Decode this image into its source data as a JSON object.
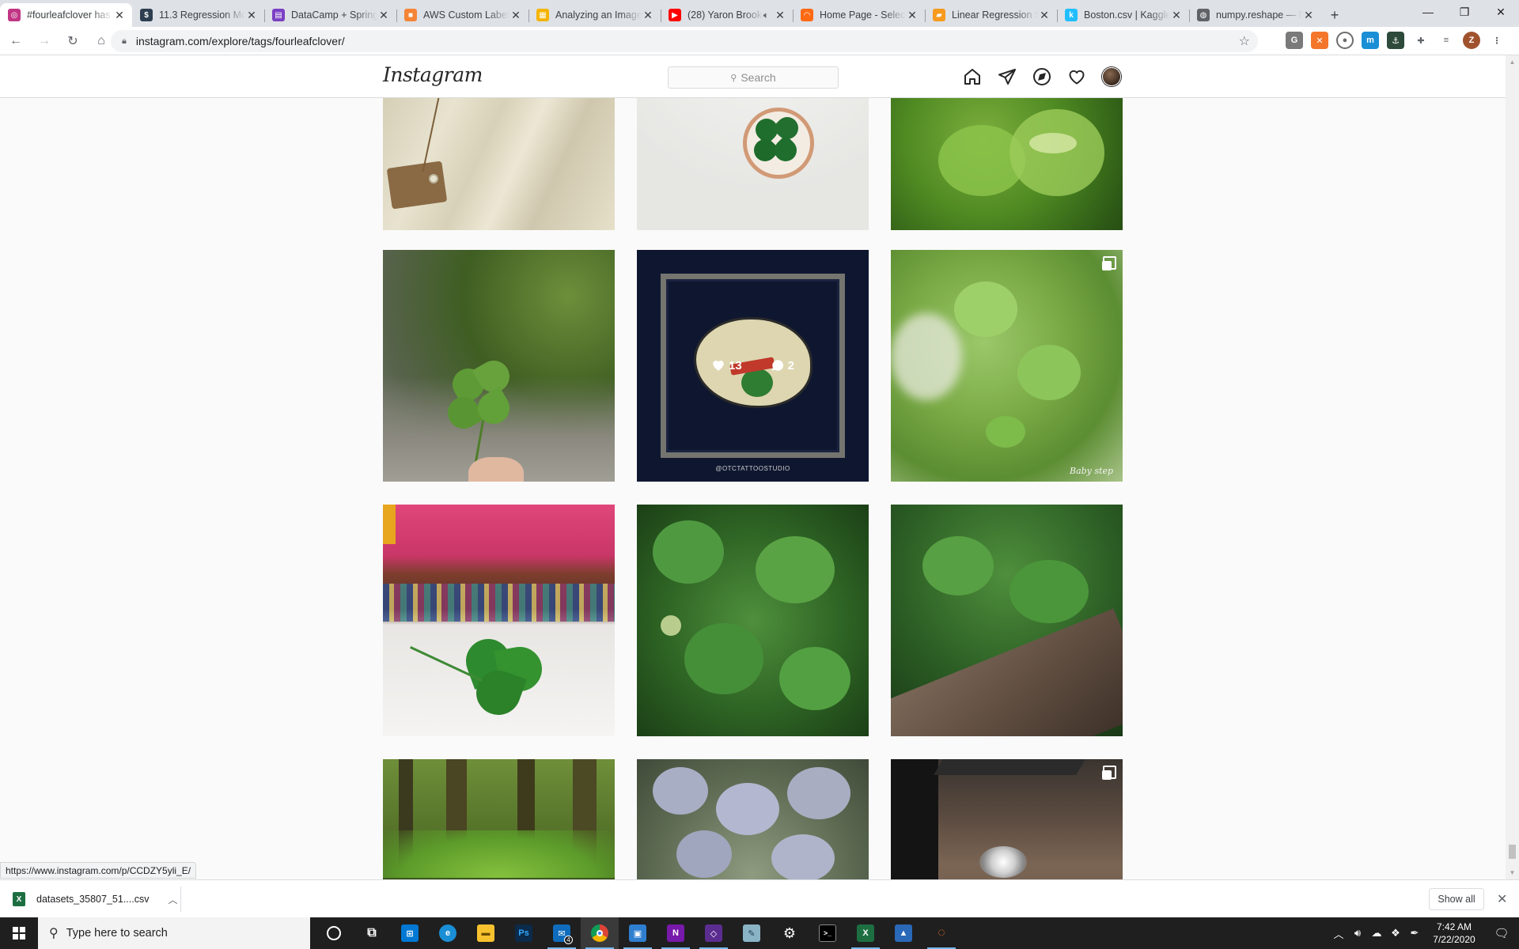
{
  "browser": {
    "tabs": [
      {
        "title": "#fourleafclover has",
        "favicon": "instagram-icon",
        "color": "#c13584",
        "glyph": "◎",
        "active": true
      },
      {
        "title": "11.3 Regression Mo",
        "favicon": "dollar-icon",
        "color": "#2d3e50",
        "glyph": "$"
      },
      {
        "title": "DataCamp + Spring",
        "favicon": "sheet-icon",
        "color": "#7b3fc4",
        "glyph": "▤"
      },
      {
        "title": "AWS Custom Labels",
        "favicon": "aws-cube-icon",
        "color": "#f58536",
        "glyph": "■"
      },
      {
        "title": "Analyzing an Image",
        "favicon": "aws-doc-icon",
        "color": "#f4b400",
        "glyph": "▦"
      },
      {
        "title": "(28) Yaron Brook",
        "favicon": "youtube-icon",
        "color": "#ff0000",
        "glyph": "▶",
        "audio": true
      },
      {
        "title": "Home Page - Select",
        "favicon": "select-icon",
        "color": "#ff6a13",
        "glyph": "◠"
      },
      {
        "title": "Linear Regression Si",
        "favicon": "book-icon",
        "color": "#f79a1e",
        "glyph": "▰"
      },
      {
        "title": "Boston.csv | Kaggle",
        "favicon": "kaggle-icon",
        "color": "#20beff",
        "glyph": "k"
      },
      {
        "title": "numpy.reshape — N",
        "favicon": "globe-icon",
        "color": "#5f6368",
        "glyph": "◍"
      }
    ],
    "url": "instagram.com/explore/tags/fourleafclover/",
    "status_url": "https://www.instagram.com/p/CCDZY5yli_E/",
    "extensions": [
      {
        "name": "grammar-ext-icon",
        "color": "#7a7a7a",
        "glyph": "G"
      },
      {
        "name": "orange-ext-icon",
        "color": "#f4762a",
        "glyph": "✕"
      },
      {
        "name": "circle-ext-icon",
        "color": "#6d6d6d",
        "glyph": "●"
      },
      {
        "name": "blue-ext-icon",
        "color": "#1a8fd6",
        "glyph": "m"
      },
      {
        "name": "green-ext-icon",
        "color": "#2d4a3a",
        "glyph": "⚓"
      },
      {
        "name": "puzzle-icon",
        "color": "#5f6368",
        "glyph": "✚"
      },
      {
        "name": "playlist-icon",
        "color": "#5f6368",
        "glyph": "≡"
      },
      {
        "name": "profile-icon",
        "color": "#a0522d",
        "glyph": "Z"
      },
      {
        "name": "more-icon",
        "color": "#5f6368",
        "glyph": "⋮"
      }
    ]
  },
  "instagram": {
    "logo": "Instagram",
    "search_placeholder": "Search"
  },
  "grid": {
    "overlay": {
      "likes": "13",
      "comments": "2"
    },
    "watermark_tattoo": "@OTCTATTOOSTUDIO",
    "watermark_baby": "Baby step"
  },
  "download": {
    "filename": "datasets_35807_51....csv",
    "show_all": "Show all"
  },
  "taskbar": {
    "search_placeholder": "Type here to search",
    "time": "7:42 AM",
    "date": "7/22/2020",
    "mail_badge": "4"
  }
}
